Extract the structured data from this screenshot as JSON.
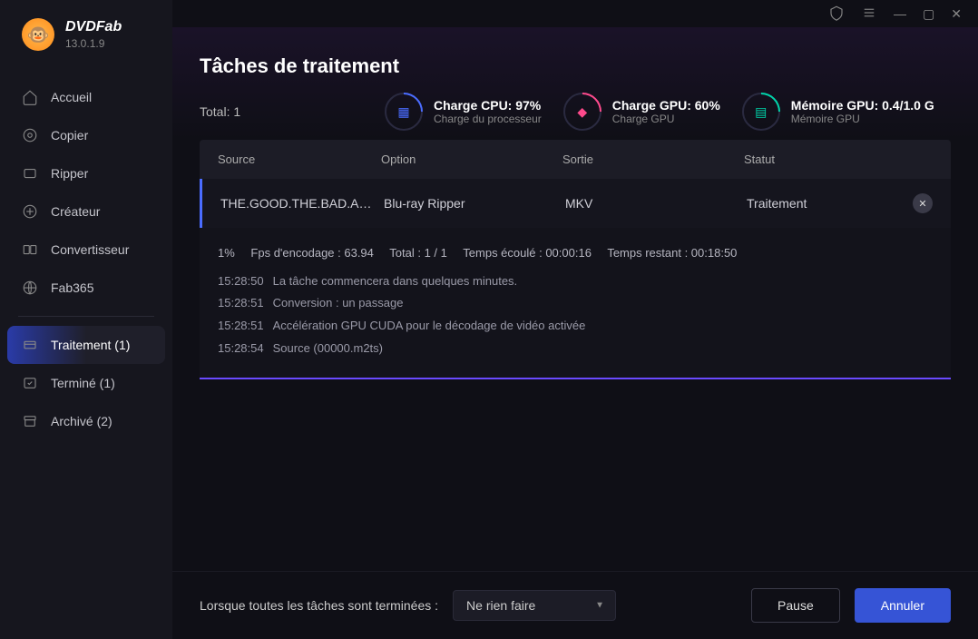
{
  "app": {
    "name": "DVDFab",
    "version": "13.0.1.9"
  },
  "sidebar": {
    "items": {
      "home": "Accueil",
      "copy": "Copier",
      "ripper": "Ripper",
      "creator": "Créateur",
      "converter": "Convertisseur",
      "fab365": "Fab365",
      "processing": "Traitement (1)",
      "finished": "Terminé (1)",
      "archived": "Archivé (2)"
    }
  },
  "header": {
    "title": "Tâches de traitement",
    "total_label": "Total: 1",
    "cpu": {
      "title": "Charge CPU: 97%",
      "sub": "Charge du processeur"
    },
    "gpu": {
      "title": "Charge GPU: 60%",
      "sub": "Charge GPU"
    },
    "mem": {
      "title": "Mémoire GPU: 0.4/1.0 G",
      "sub": "Mémoire GPU"
    }
  },
  "columns": {
    "source": "Source",
    "option": "Option",
    "output": "Sortie",
    "status": "Statut"
  },
  "task": {
    "source": "THE.GOOD.THE.BAD.AN…",
    "option": "Blu-ray Ripper",
    "output": "MKV",
    "status": "Traitement"
  },
  "log": {
    "percent": "1%",
    "fps": "Fps d'encodage : 63.94",
    "total": "Total : 1 / 1",
    "elapsed": "Temps écoulé : 00:00:16",
    "remaining": "Temps restant : 00:18:50",
    "lines": [
      {
        "t": "15:28:50",
        "m": "La tâche commencera dans quelques minutes."
      },
      {
        "t": "15:28:51",
        "m": "Conversion : un passage"
      },
      {
        "t": "15:28:51",
        "m": "Accélération GPU CUDA pour le décodage de vidéo activée"
      },
      {
        "t": "15:28:54",
        "m": "Source (00000.m2ts)"
      }
    ]
  },
  "footer": {
    "label": "Lorsque toutes les tâches sont terminées :",
    "selected": "Ne rien faire",
    "pause": "Pause",
    "cancel": "Annuler"
  }
}
